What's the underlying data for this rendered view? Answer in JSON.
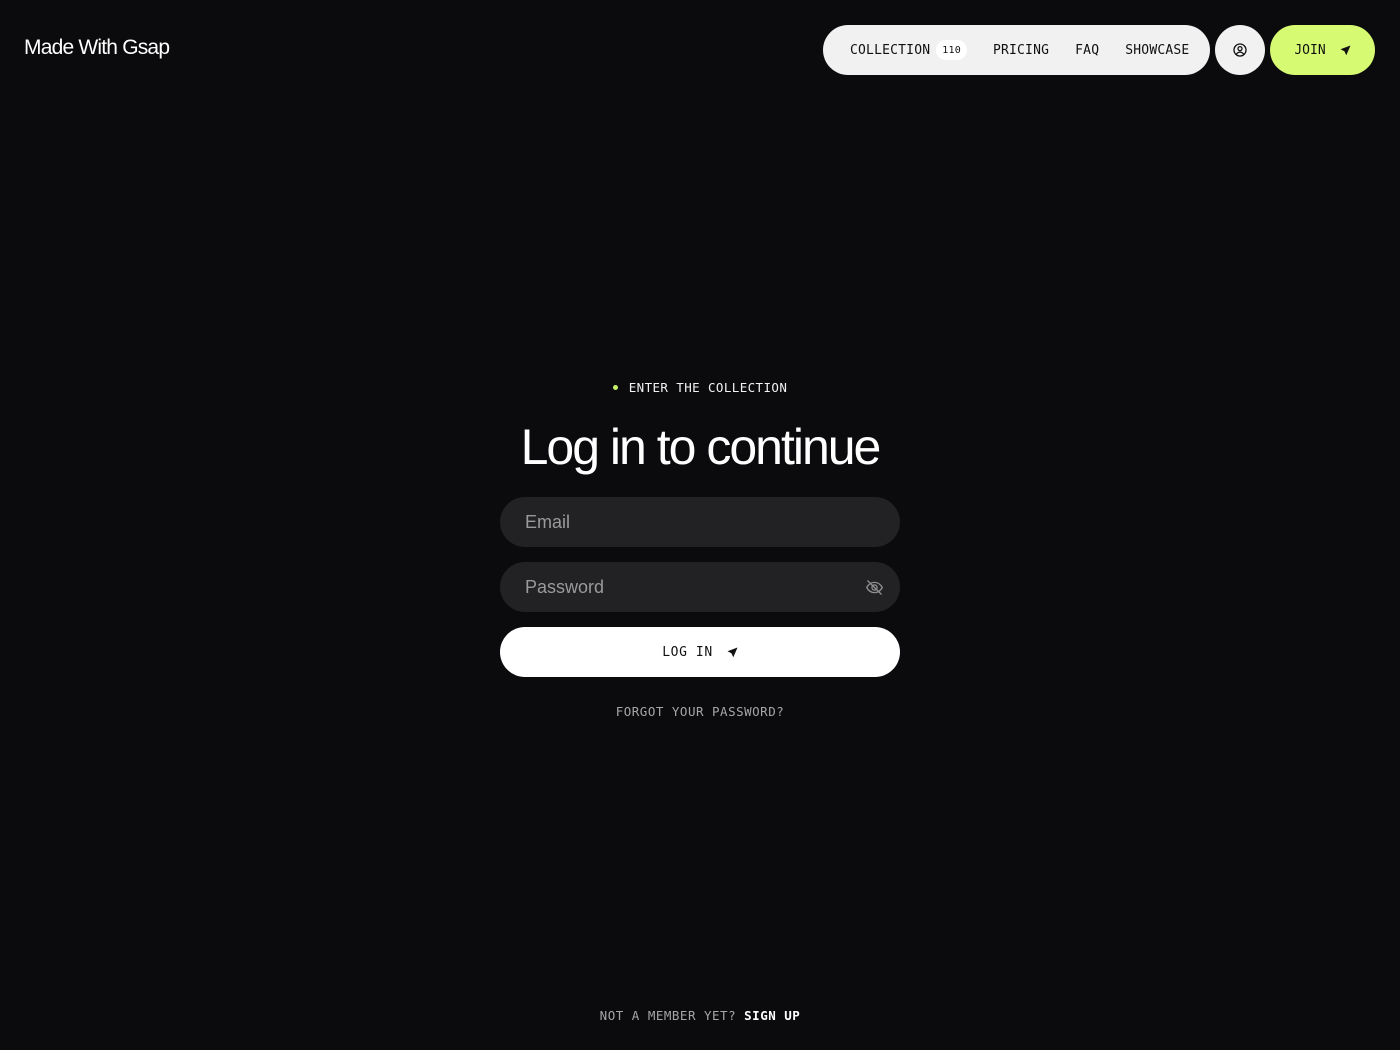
{
  "header": {
    "logo": "Made With Gsap",
    "nav": {
      "collection_label": "COLLECTION",
      "collection_count": "110",
      "pricing_label": "PRICING",
      "faq_label": "FAQ",
      "showcase_label": "SHOWCASE"
    },
    "user_icon": "user-circle-icon",
    "join_label": "JOIN",
    "join_icon": "send-arrow-icon"
  },
  "login": {
    "eyebrow": "ENTER THE COLLECTION",
    "title": "Log in to continue",
    "email_placeholder": "Email",
    "email_value": "",
    "password_placeholder": "Password",
    "password_value": "",
    "password_toggle_icon": "eye-off-icon",
    "submit_label": "LOG IN",
    "submit_icon": "send-arrow-icon",
    "forgot_label": "FORGOT YOUR PASSWORD?"
  },
  "footer": {
    "prompt": "NOT A MEMBER YET?",
    "signup_label": "SIGN UP"
  },
  "colors": {
    "background": "#0b0b0d",
    "accent": "#d6fb73",
    "field_bg": "#222224",
    "nav_bg": "#f1f1f1"
  }
}
